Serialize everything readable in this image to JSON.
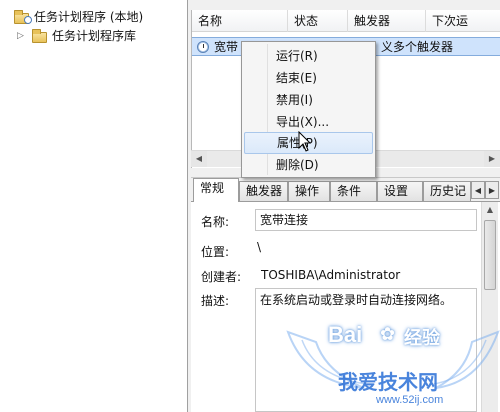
{
  "tree": {
    "root_label": "任务计划程序 (本地)",
    "library_label": "任务计划程序库"
  },
  "tasklist": {
    "columns": [
      "名称",
      "状态",
      "触发器",
      "下次运"
    ],
    "row": {
      "name": "宽带",
      "trigger": "义多个触发器"
    }
  },
  "context_menu": {
    "items": [
      "运行(R)",
      "结束(E)",
      "禁用(I)",
      "导出(X)...",
      "属性(P)",
      "删除(D)"
    ],
    "highlighted_index": 4
  },
  "props": {
    "tabs": [
      "常规",
      "触发器",
      "操作",
      "条件",
      "设置",
      "历史记"
    ],
    "active_tab": 0,
    "fields": {
      "name_label": "名称:",
      "name_value": "宽带连接",
      "location_label": "位置:",
      "location_value": "\\",
      "author_label": "创建者:",
      "author_value": "TOSHIBA\\Administrator",
      "desc_label": "描述:",
      "desc_value": "在系统启动或登录时自动连接网络。"
    }
  },
  "watermark": {
    "brand": "Bai",
    "brand_cn": "经验",
    "slogan": "我爱技术网",
    "url": "www.52ij.com"
  },
  "icons": {
    "folder": "folder-icon",
    "clock": "clock-icon",
    "cursor": "pointer-cursor-icon"
  },
  "colors": {
    "selection": "#cfe3fc",
    "menu_highlight": "#dbe9fa",
    "watermark": "#2a6fd6"
  }
}
